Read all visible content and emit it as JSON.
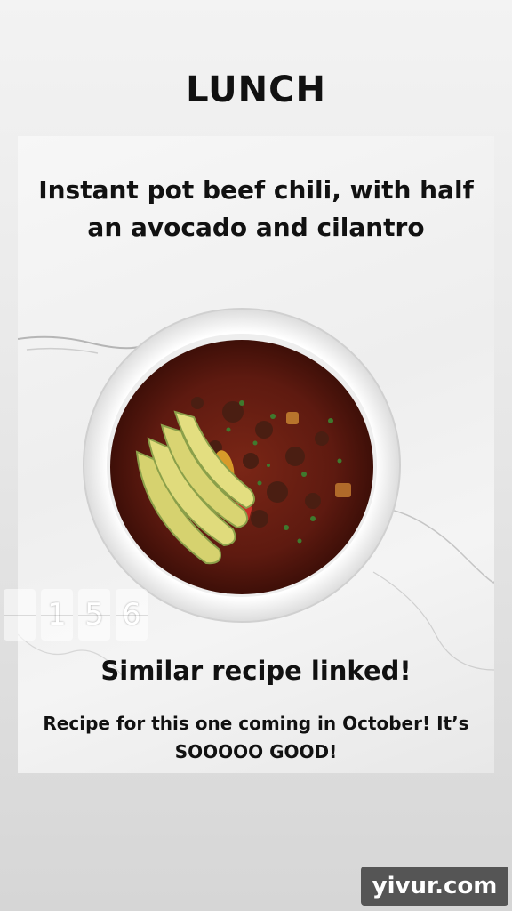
{
  "story": {
    "heading": "LUNCH",
    "caption_top": "Instant pot beef chili, with half an avocado and cilantro",
    "caption_middle": "Similar recipe linked!",
    "caption_bottom": "Recipe for this one coming in October! It’s SOOOOO GOOD!",
    "counter_digits": [
      "",
      "1",
      "5",
      "6"
    ]
  },
  "watermark": {
    "text": "yivur.com"
  },
  "colors": {
    "bowl": "#ffffff",
    "chili": "#6b1d13",
    "avocado": "#d9d67a",
    "marble": "#f0f0f0"
  },
  "icons": [
    "chili-bowl-photo"
  ]
}
